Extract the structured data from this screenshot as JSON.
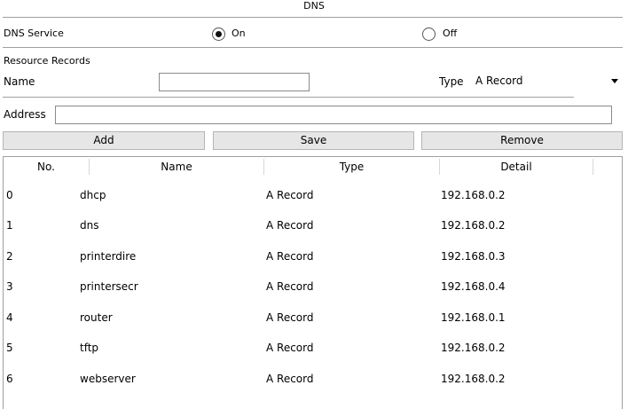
{
  "title": "DNS",
  "dns_service": {
    "label": "DNS Service",
    "on_label": "On",
    "off_label": "Off",
    "selected": "On"
  },
  "resource_records_label": "Resource Records",
  "name_label": "Name",
  "name_value": "",
  "type_label": "Type",
  "type_value": "A Record",
  "address_label": "Address",
  "address_value": "",
  "buttons": {
    "add": "Add",
    "save": "Save",
    "remove": "Remove"
  },
  "table": {
    "headers": [
      "No.",
      "Name",
      "Type",
      "Detail"
    ],
    "rows": [
      [
        "0",
        "dhcp",
        "A Record",
        "192.168.0.2"
      ],
      [
        "1",
        "dns",
        "A Record",
        "192.168.0.2"
      ],
      [
        "2",
        "printerdire",
        "A Record",
        "192.168.0.3"
      ],
      [
        "3",
        "printersecr",
        "A Record",
        "192.168.0.4"
      ],
      [
        "4",
        "router",
        "A Record",
        "192.168.0.1"
      ],
      [
        "5",
        "tftp",
        "A Record",
        "192.168.0.2"
      ],
      [
        "6",
        "webserver",
        "A Record",
        "192.168.0.2"
      ]
    ]
  }
}
